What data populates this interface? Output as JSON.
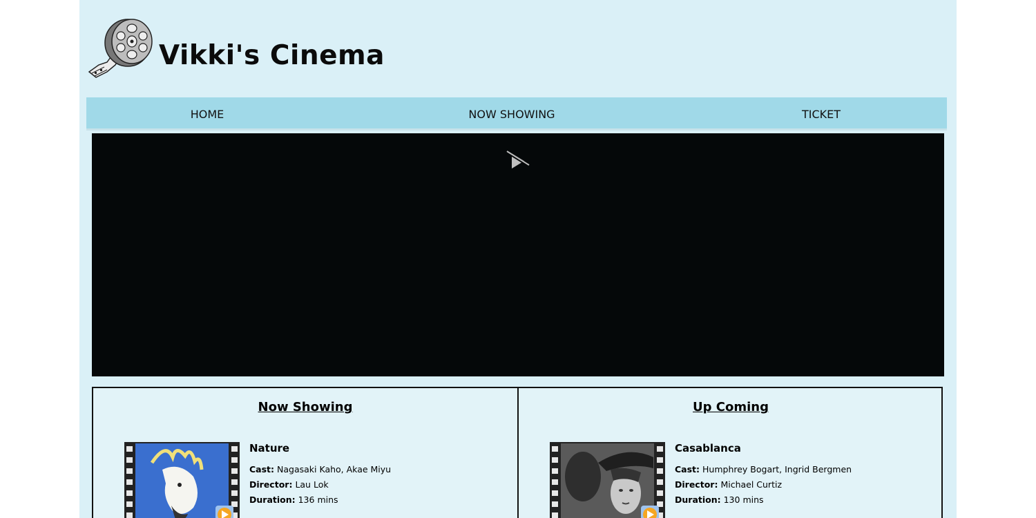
{
  "site": {
    "title": "Vikki's Cinema"
  },
  "nav": {
    "items": [
      {
        "label": "HOME"
      },
      {
        "label": "NOW SHOWING"
      },
      {
        "label": "TICKET"
      }
    ]
  },
  "video": {
    "icon": "play-disabled-icon"
  },
  "sections": {
    "now_showing": {
      "heading": "Now Showing",
      "movie": {
        "title": "Nature",
        "cast_label": "Cast:",
        "cast": "Nagasaki Kaho, Akae Miyu",
        "director_label": "Director:",
        "director": "Lau Lok",
        "duration_label": "Duration:",
        "duration": "136 mins"
      }
    },
    "up_coming": {
      "heading": "Up Coming",
      "movie": {
        "title": "Casablanca",
        "cast_label": "Cast:",
        "cast": "Humphrey Bogart, Ingrid Bergmen",
        "director_label": "Director:",
        "director": "Michael Curtiz",
        "duration_label": "Duration:",
        "duration": "130 mins"
      }
    }
  },
  "colors": {
    "page_bg": "#daf0f7",
    "nav_bg": "#a0d9e8",
    "video_bg": "#050809",
    "panel_bg": "#e2f3f8",
    "play_badge": "#f5a623"
  }
}
